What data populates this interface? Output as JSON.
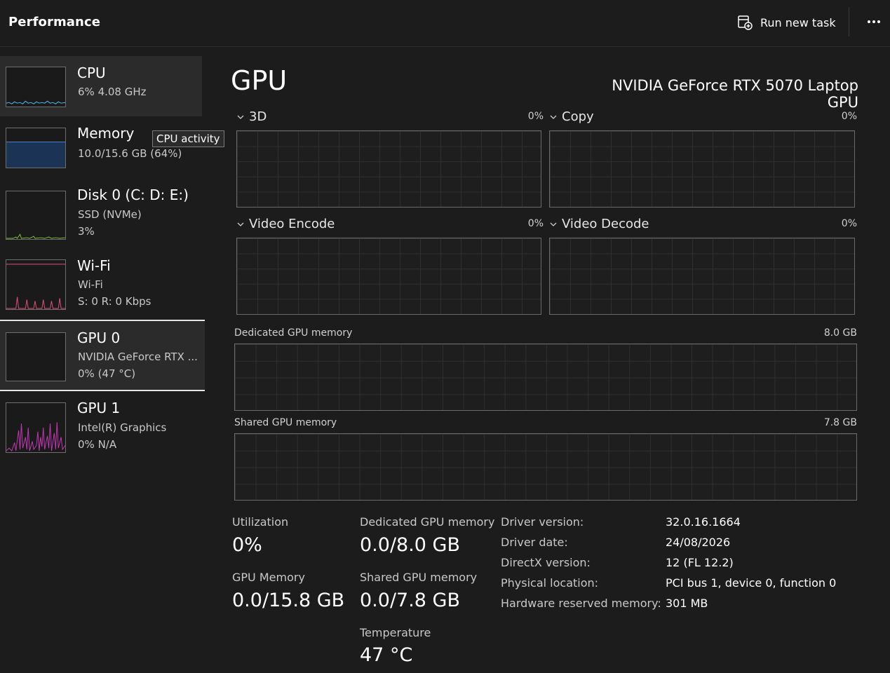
{
  "header": {
    "title": "Performance",
    "run_new_task": "Run new task"
  },
  "sidebar": {
    "items": [
      {
        "title": "CPU",
        "line1": "6%  4.08 GHz",
        "line2": ""
      },
      {
        "title": "Memory",
        "line1": "10.0/15.6 GB (64%)",
        "line2": ""
      },
      {
        "title": "Disk 0 (C: D: E:)",
        "line1": "SSD (NVMe)",
        "line2": "3%"
      },
      {
        "title": "Wi-Fi",
        "line1": "Wi-Fi",
        "line2": "S: 0  R: 0 Kbps"
      },
      {
        "title": "GPU 0",
        "line1": "NVIDIA GeForce RTX ...",
        "line2": "0%  (47 °C)"
      },
      {
        "title": "GPU 1",
        "line1": "Intel(R) Graphics",
        "line2": "0%  N/A"
      }
    ],
    "tooltip": "CPU activity"
  },
  "main": {
    "heading": "GPU",
    "model": "NVIDIA GeForce RTX 5070 Laptop GPU",
    "engines": [
      {
        "name": "3D",
        "value": "0%"
      },
      {
        "name": "Copy",
        "value": "0%"
      },
      {
        "name": "Video Encode",
        "value": "0%"
      },
      {
        "name": "Video Decode",
        "value": "0%"
      }
    ],
    "dedicated_memory": {
      "label": "Dedicated GPU memory",
      "max": "8.0 GB"
    },
    "shared_memory": {
      "label": "Shared GPU memory",
      "max": "7.8 GB"
    },
    "stats": {
      "utilization": {
        "label": "Utilization",
        "value": "0%"
      },
      "dedicated": {
        "label": "Dedicated GPU memory",
        "value": "0.0/8.0 GB"
      },
      "gpu_memory": {
        "label": "GPU Memory",
        "value": "0.0/15.8 GB"
      },
      "shared": {
        "label": "Shared GPU memory",
        "value": "0.0/7.8 GB"
      },
      "temperature": {
        "label": "Temperature",
        "value": "47 °C"
      }
    },
    "info": [
      {
        "label": "Driver version:",
        "value": "32.0.16.1664"
      },
      {
        "label": "Driver date:",
        "value": "24/08/2026"
      },
      {
        "label": "DirectX version:",
        "value": "12 (FL 12.2)"
      },
      {
        "label": "Physical location:",
        "value": "PCI bus 1, device 0, function 0"
      },
      {
        "label": "Hardware reserved memory:",
        "value": "301 MB"
      }
    ]
  },
  "colors": {
    "cpu": "#4cc2ff",
    "memory": "#2d5fa8",
    "disk": "#7fc241",
    "wifi": "#e2507a",
    "gpu1": "#c239b3"
  }
}
